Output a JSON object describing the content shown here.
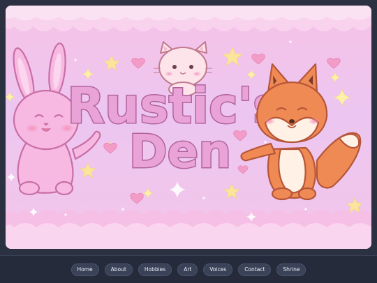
{
  "banner": {
    "title_line1": "Rustic's",
    "title_line2": "Den",
    "colors": {
      "bg_top": "#f7c7ea",
      "bg_mid": "#e8c6f2",
      "title_fill": "#eaa3d6",
      "title_stroke": "#b0639f",
      "fox_orange": "#f08a54",
      "bunny_pink": "#f7b9e2",
      "cat_cream": "#fde3ea",
      "star_yellow": "#fbe59a"
    },
    "characters": [
      "bunny",
      "cat",
      "fox"
    ]
  },
  "nav": {
    "items": [
      {
        "label": "Home",
        "name": "nav-home"
      },
      {
        "label": "About",
        "name": "nav-about"
      },
      {
        "label": "Hobbies",
        "name": "nav-hobbies"
      },
      {
        "label": "Art",
        "name": "nav-art"
      },
      {
        "label": "Voices",
        "name": "nav-voices"
      },
      {
        "label": "Contact",
        "name": "nav-contact"
      },
      {
        "label": "Shrine",
        "name": "nav-shrine"
      }
    ]
  }
}
